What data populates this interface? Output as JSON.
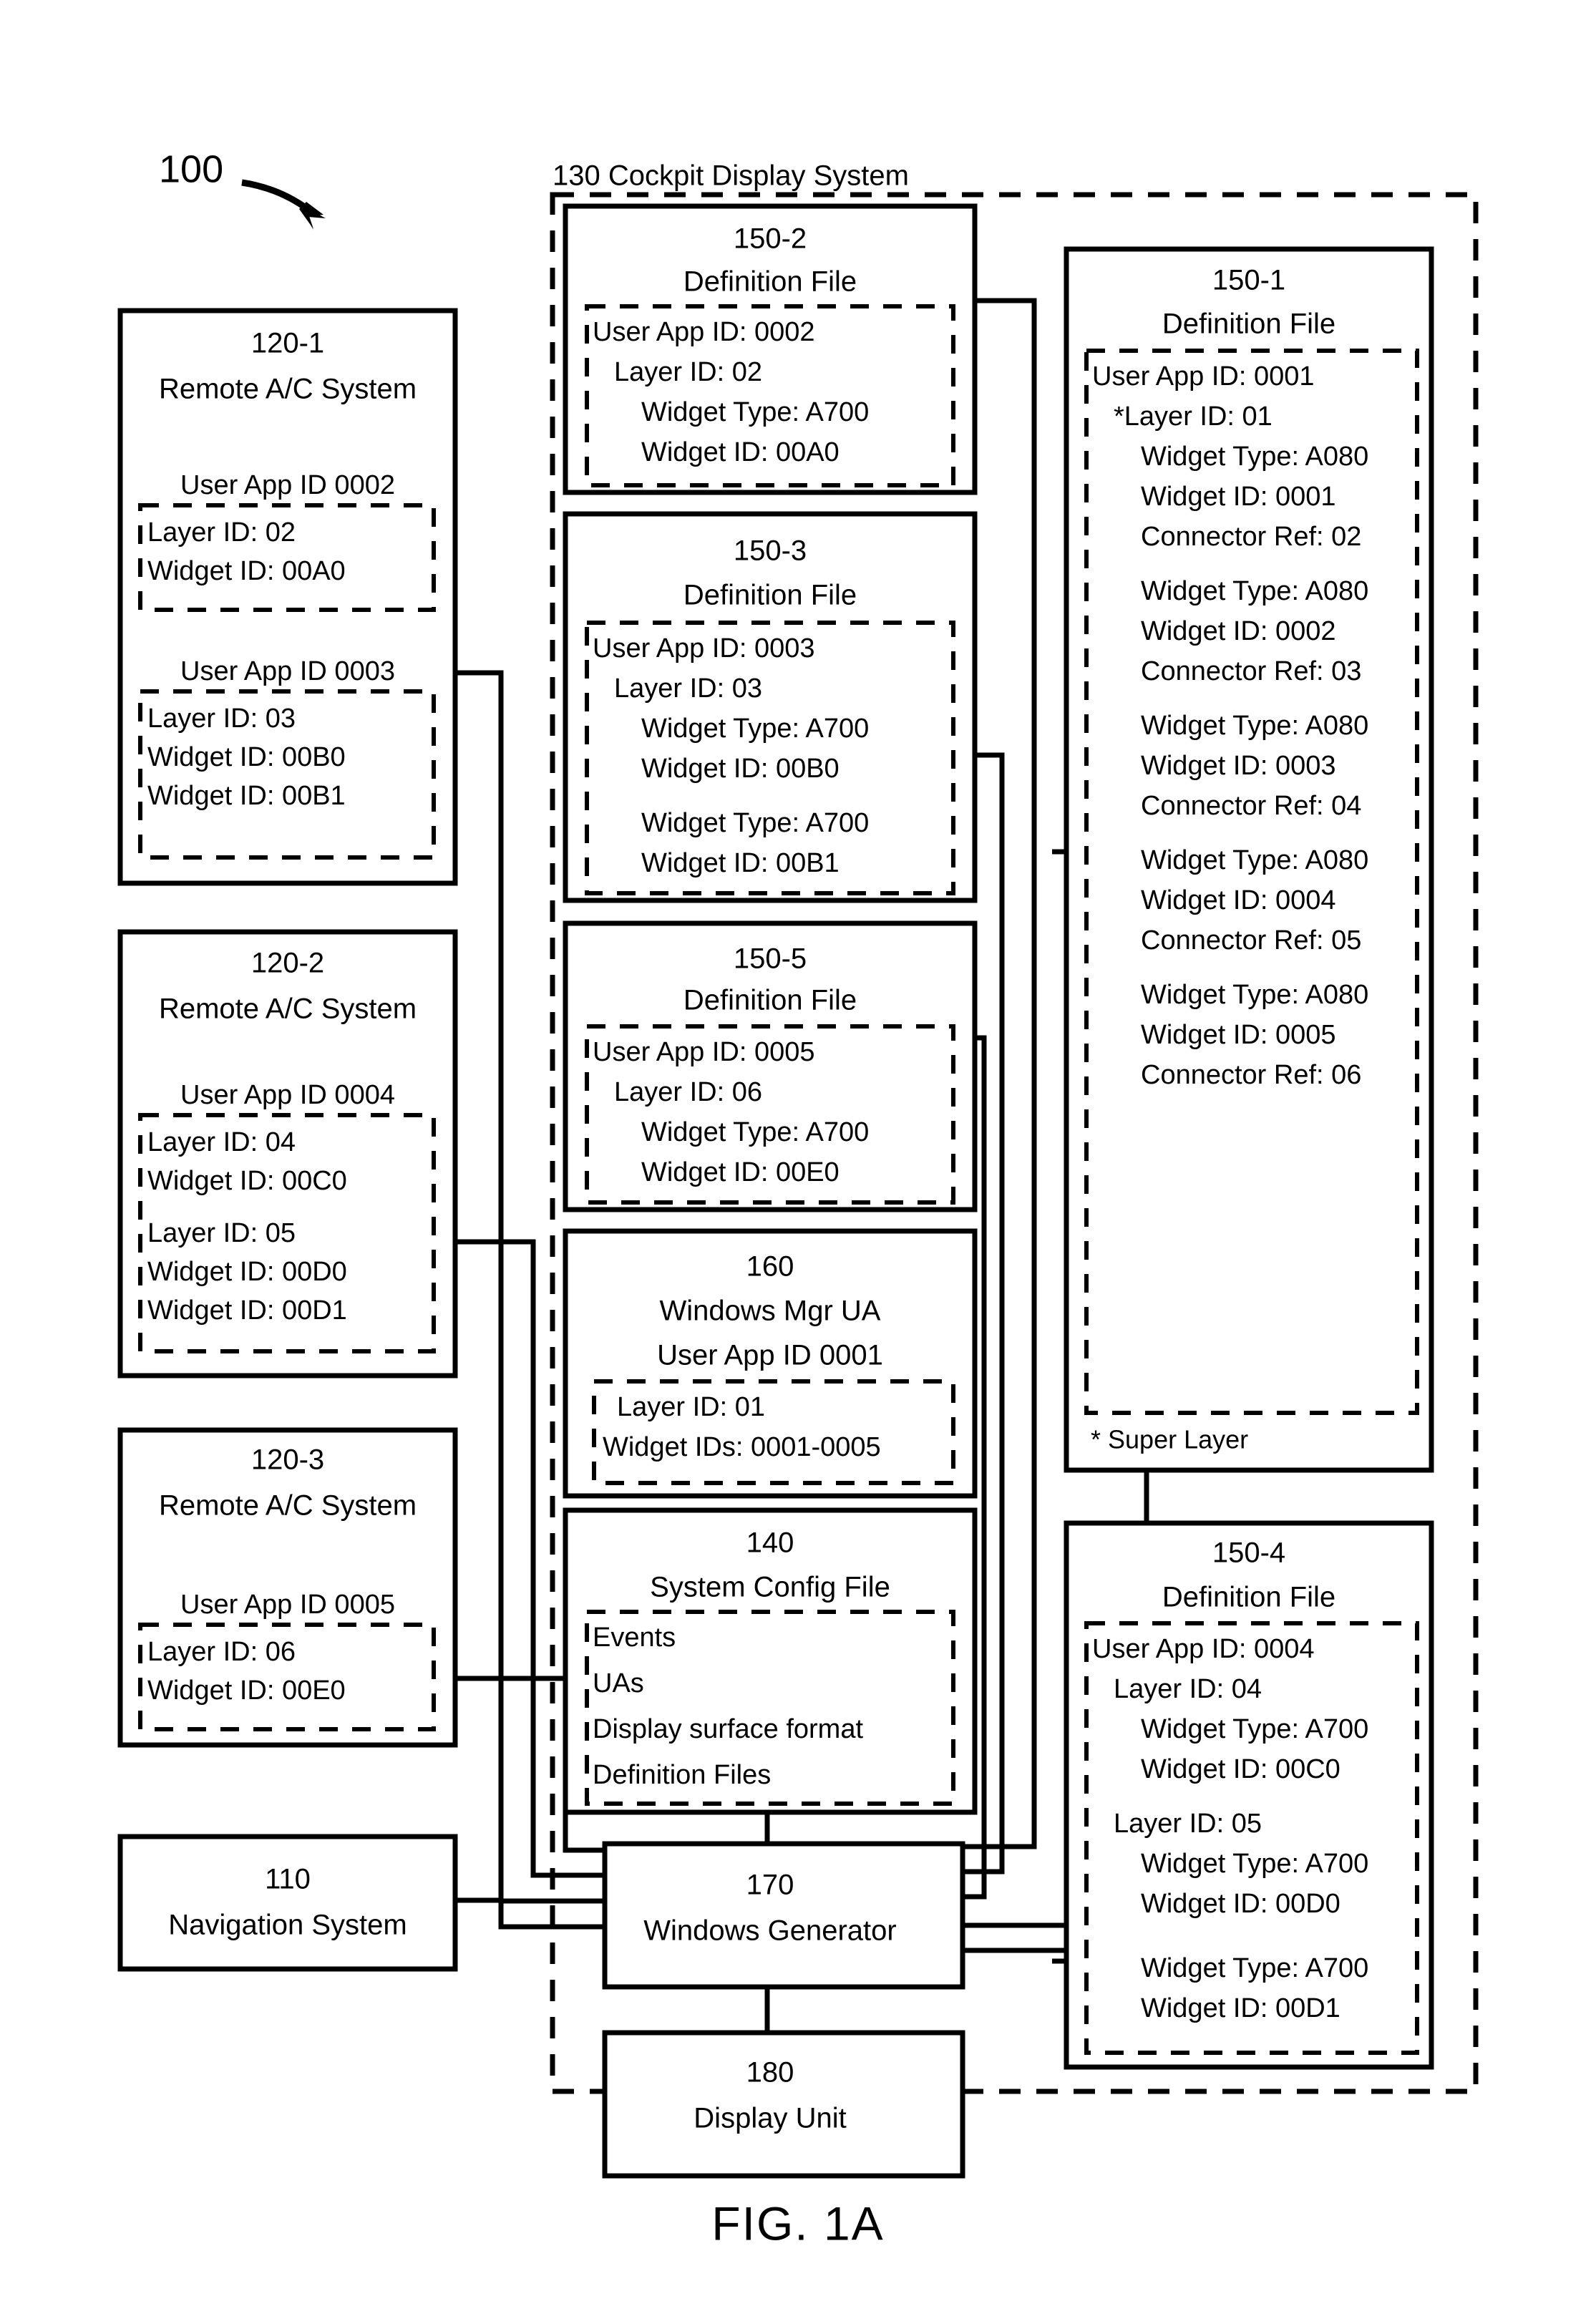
{
  "figure": {
    "caption": "FIG. 1A",
    "system_ref": "100"
  },
  "cockpit_display_system": {
    "header": "130 Cockpit Display System"
  },
  "remote_systems": [
    {
      "ref": "120-1",
      "title": "Remote A/C System",
      "apps": [
        {
          "header": "User App ID 0002",
          "lines": [
            "Layer ID: 02",
            "Widget ID: 00A0"
          ]
        },
        {
          "header": "User App ID 0003",
          "lines": [
            "Layer ID: 03",
            "Widget ID: 00B0",
            "Widget ID: 00B1"
          ]
        }
      ]
    },
    {
      "ref": "120-2",
      "title": "Remote A/C System",
      "apps": [
        {
          "header": "User App ID 0004",
          "lines": [
            "Layer ID: 04",
            "Widget ID: 00C0",
            "",
            "Layer ID: 05",
            "Widget ID: 00D0",
            "Widget ID: 00D1"
          ]
        }
      ]
    },
    {
      "ref": "120-3",
      "title": "Remote A/C System",
      "apps": [
        {
          "header": "User App ID 0005",
          "lines": [
            "Layer ID: 06",
            "Widget ID: 00E0"
          ]
        }
      ]
    }
  ],
  "navigation_system": {
    "ref": "110",
    "title": "Navigation System"
  },
  "definition_files": {
    "df_150_2": {
      "ref": "150-2",
      "title": "Definition File",
      "lines": [
        {
          "text": "User App ID: 0002",
          "indent": 0
        },
        {
          "text": "Layer ID: 02",
          "indent": 1
        },
        {
          "text": "Widget Type: A700",
          "indent": 2
        },
        {
          "text": "Widget ID: 00A0",
          "indent": 2
        }
      ]
    },
    "df_150_3": {
      "ref": "150-3",
      "title": "Definition File",
      "lines": [
        {
          "text": "User App ID: 0003",
          "indent": 0
        },
        {
          "text": "Layer ID: 03",
          "indent": 1
        },
        {
          "text": "Widget Type: A700",
          "indent": 2
        },
        {
          "text": "Widget ID: 00B0",
          "indent": 2
        },
        {
          "text": "",
          "indent": 0
        },
        {
          "text": "Widget Type: A700",
          "indent": 2
        },
        {
          "text": "Widget ID: 00B1",
          "indent": 2
        }
      ]
    },
    "df_150_5": {
      "ref": "150-5",
      "title": "Definition File",
      "lines": [
        {
          "text": "User App ID: 0005",
          "indent": 0
        },
        {
          "text": "Layer ID: 06",
          "indent": 1
        },
        {
          "text": "Widget Type: A700",
          "indent": 2
        },
        {
          "text": "Widget ID: 00E0",
          "indent": 2
        }
      ]
    },
    "df_150_1": {
      "ref": "150-1",
      "title": "Definition File",
      "footnote": "* Super Layer",
      "lines": [
        {
          "text": "User App ID: 0001",
          "indent": 0
        },
        {
          "text": "*Layer ID: 01",
          "indent": 1
        },
        {
          "text": "Widget Type: A080",
          "indent": 2
        },
        {
          "text": "Widget ID: 0001",
          "indent": 2
        },
        {
          "text": "Connector Ref: 02",
          "indent": 2
        },
        {
          "text": "",
          "indent": 0
        },
        {
          "text": "Widget Type: A080",
          "indent": 2
        },
        {
          "text": "Widget ID: 0002",
          "indent": 2
        },
        {
          "text": "Connector Ref: 03",
          "indent": 2
        },
        {
          "text": "",
          "indent": 0
        },
        {
          "text": "Widget Type: A080",
          "indent": 2
        },
        {
          "text": "Widget ID: 0003",
          "indent": 2
        },
        {
          "text": "Connector Ref: 04",
          "indent": 2
        },
        {
          "text": "",
          "indent": 0
        },
        {
          "text": "Widget Type: A080",
          "indent": 2
        },
        {
          "text": "Widget ID: 0004",
          "indent": 2
        },
        {
          "text": "Connector Ref: 05",
          "indent": 2
        },
        {
          "text": "",
          "indent": 0
        },
        {
          "text": "Widget Type: A080",
          "indent": 2
        },
        {
          "text": "Widget ID: 0005",
          "indent": 2
        },
        {
          "text": "Connector Ref: 06",
          "indent": 2
        }
      ]
    },
    "df_150_4": {
      "ref": "150-4",
      "title": "Definition File",
      "lines": [
        {
          "text": "User App ID: 0004",
          "indent": 0
        },
        {
          "text": "Layer ID: 04",
          "indent": 1
        },
        {
          "text": "Widget Type: A700",
          "indent": 2
        },
        {
          "text": "Widget ID: 00C0",
          "indent": 2
        },
        {
          "text": "",
          "indent": 0
        },
        {
          "text": "Layer ID: 05",
          "indent": 1
        },
        {
          "text": "Widget Type: A700",
          "indent": 2
        },
        {
          "text": "Widget ID: 00D0",
          "indent": 2
        },
        {
          "text": "",
          "indent": 0
        },
        {
          "text": "Widget Type: A700",
          "indent": 2
        },
        {
          "text": "Widget ID: 00D1",
          "indent": 2
        }
      ]
    }
  },
  "windows_mgr_ua": {
    "ref": "160",
    "title": "Windows Mgr UA",
    "subtitle": "User App ID 0001",
    "lines": [
      "Layer ID: 01",
      "Widget IDs: 0001-0005"
    ]
  },
  "system_config_file": {
    "ref": "140",
    "title": "System Config File",
    "lines": [
      "Events",
      "UAs",
      "Display surface format",
      "Definition Files"
    ]
  },
  "windows_generator": {
    "ref": "170",
    "title": "Windows Generator"
  },
  "display_unit": {
    "ref": "180",
    "title": "Display Unit"
  }
}
